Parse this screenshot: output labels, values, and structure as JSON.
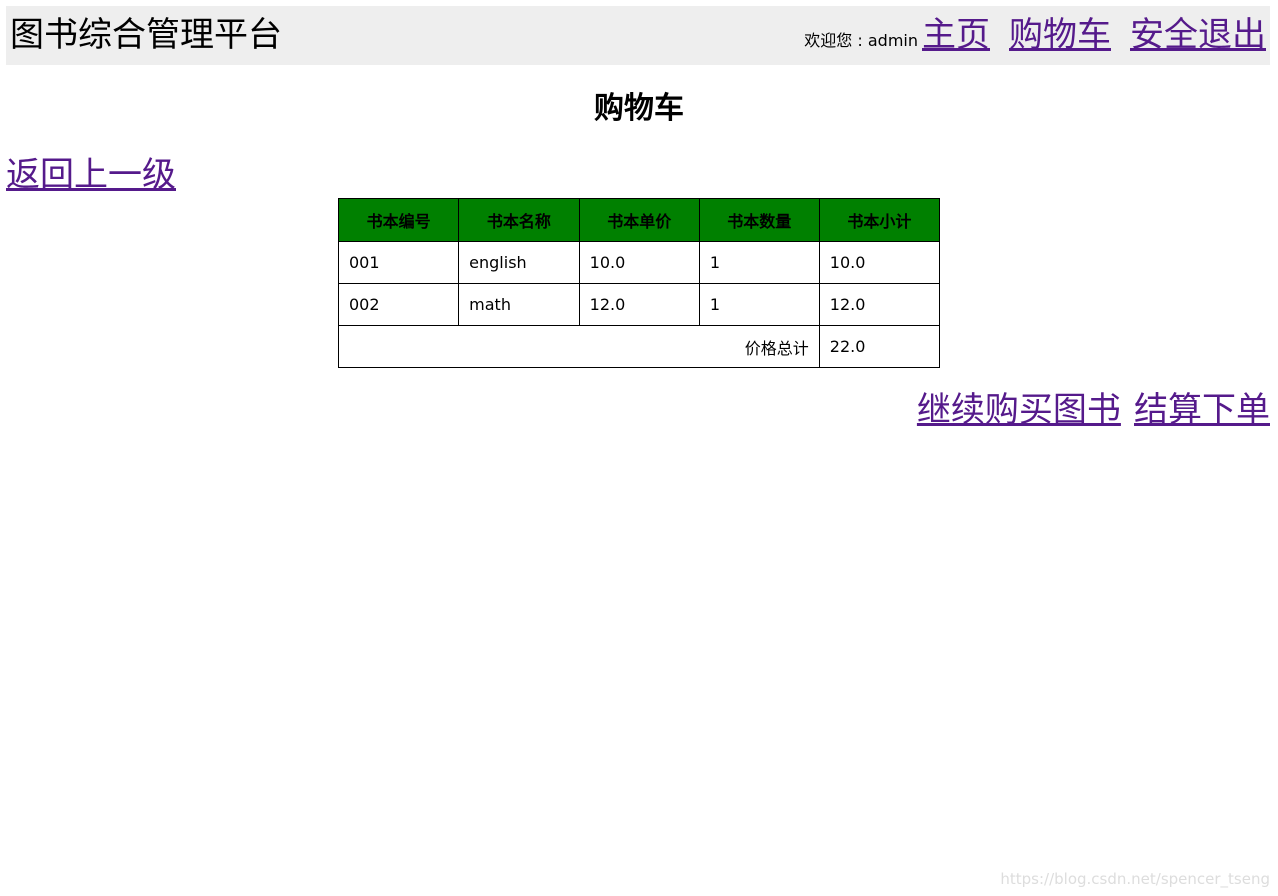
{
  "header": {
    "title": "图书综合管理平台",
    "welcome": "欢迎您 : admin",
    "nav": [
      "主页",
      "购物车",
      "安全退出"
    ]
  },
  "page": {
    "title": "购物车",
    "back_link": "返回上一级"
  },
  "table": {
    "headers": [
      "书本编号",
      "书本名称",
      "书本单价",
      "书本数量",
      "书本小计"
    ],
    "rows": [
      [
        "001",
        "english",
        "10.0",
        "1",
        "10.0"
      ],
      [
        "002",
        "math",
        "12.0",
        "1",
        "12.0"
      ]
    ],
    "total_label": "价格总计",
    "total_value": "22.0"
  },
  "actions": {
    "continue": "继续购买图书",
    "checkout": "结算下单"
  },
  "watermark": "https://blog.csdn.net/spencer_tseng",
  "colors": {
    "header_bg": "#eeeeee",
    "table_header_bg": "#008000",
    "link": "#551a8b"
  }
}
